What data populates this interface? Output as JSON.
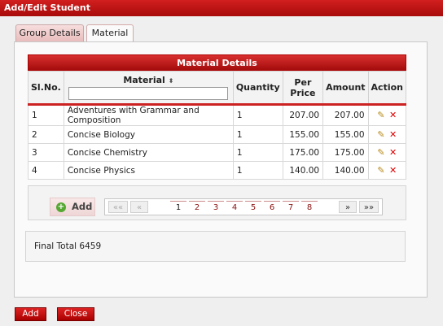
{
  "window": {
    "title": "Add/Edit Student"
  },
  "tabs": [
    {
      "label": "Group Details"
    },
    {
      "label": "Material"
    }
  ],
  "grid": {
    "caption": "Material Details",
    "columns": {
      "slno": "Sl.No.",
      "material": "Material",
      "quantity": "Quantity",
      "per_price": "Per Price",
      "amount": "Amount",
      "action": "Action"
    },
    "rows": [
      {
        "slno": "1",
        "material": "Adventures with Grammar and Composition",
        "quantity": "1",
        "per_price": "207.00",
        "amount": "207.00"
      },
      {
        "slno": "2",
        "material": "Concise Biology",
        "quantity": "1",
        "per_price": "155.00",
        "amount": "155.00"
      },
      {
        "slno": "3",
        "material": "Concise Chemistry",
        "quantity": "1",
        "per_price": "175.00",
        "amount": "175.00"
      },
      {
        "slno": "4",
        "material": "Concise Physics",
        "quantity": "1",
        "per_price": "140.00",
        "amount": "140.00"
      }
    ],
    "sort_glyph": "⬍",
    "row_icons": [
      "edit-icon",
      "delete-icon"
    ]
  },
  "pager": {
    "add_label": "Add",
    "first": "««",
    "prev": "«",
    "pages": [
      "1",
      "2",
      "3",
      "4",
      "5",
      "6",
      "7",
      "8"
    ],
    "current_page": "1",
    "next": "»",
    "last": "»»"
  },
  "total": {
    "text": "Final Total 6459"
  },
  "footer": {
    "add_label": "Add",
    "close_label": "Close"
  },
  "colors": {
    "accent": "#b51212",
    "link_page": "#8a1010"
  }
}
